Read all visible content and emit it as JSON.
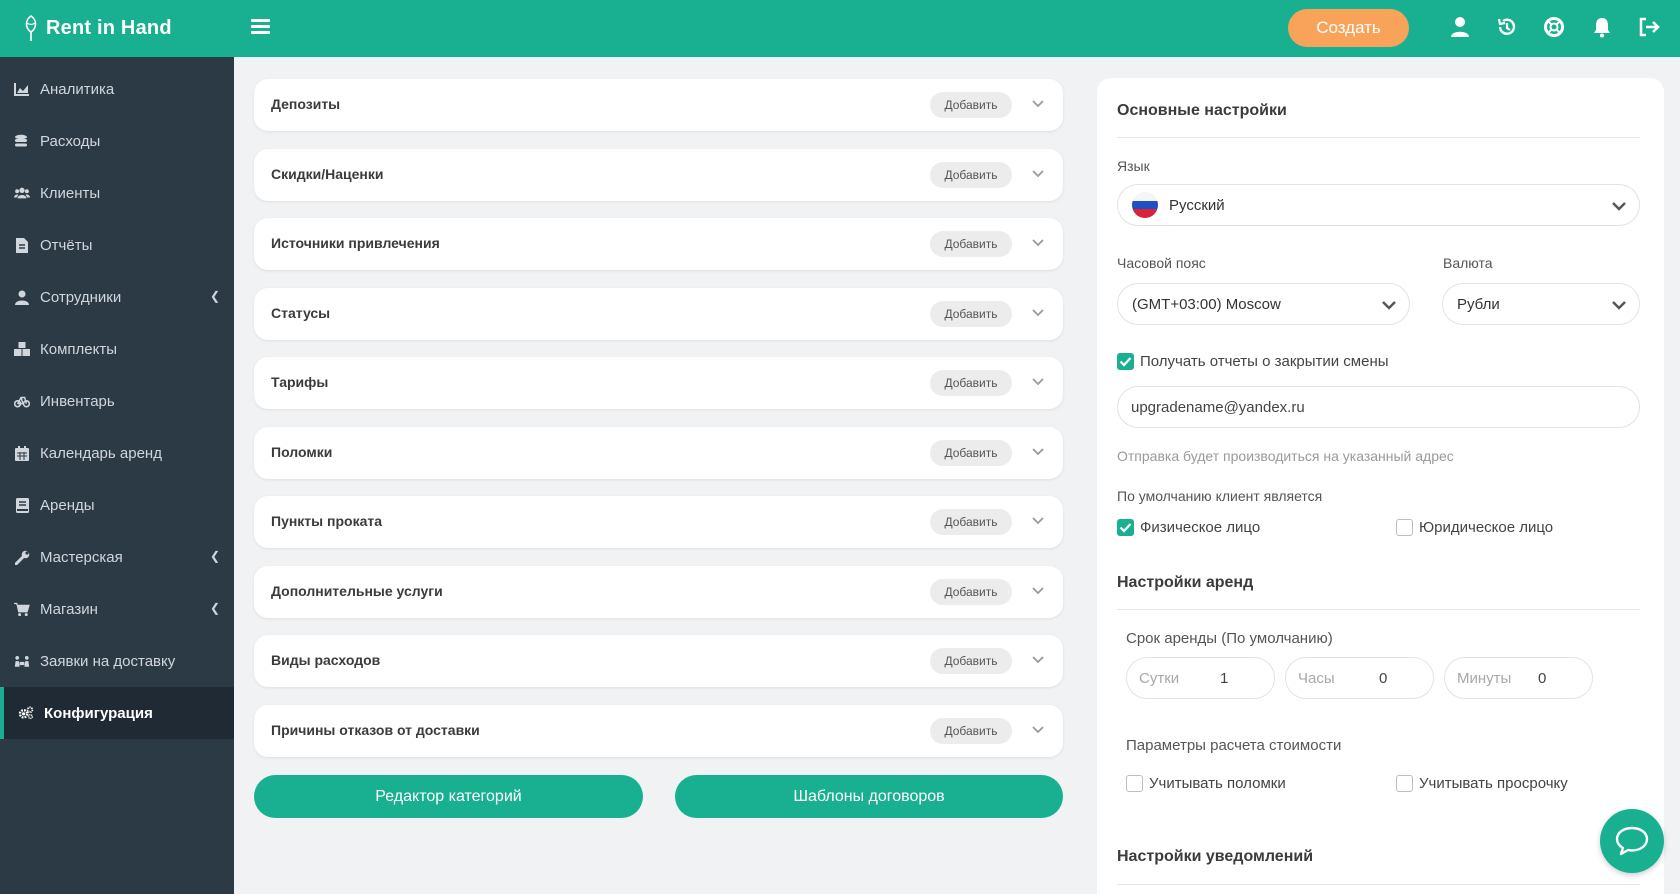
{
  "app": {
    "name": "Rent in Hand"
  },
  "header": {
    "create_label": "Создать"
  },
  "sidebar": {
    "items": [
      {
        "label": "Аналитика",
        "icon": "chart-icon"
      },
      {
        "label": "Расходы",
        "icon": "coins-icon"
      },
      {
        "label": "Клиенты",
        "icon": "users-icon"
      },
      {
        "label": "Отчёты",
        "icon": "file-icon"
      },
      {
        "label": "Сотрудники",
        "icon": "user-tie-icon"
      },
      {
        "label": "Комплекты",
        "icon": "boxes-icon"
      },
      {
        "label": "Инвентарь",
        "icon": "bicycle-icon"
      },
      {
        "label": "Календарь аренд",
        "icon": "calendar-icon"
      },
      {
        "label": "Аренды",
        "icon": "book-icon"
      },
      {
        "label": "Мастерская",
        "icon": "wrench-icon"
      },
      {
        "label": "Магазин",
        "icon": "cart-icon"
      },
      {
        "label": "Заявки на доставку",
        "icon": "delivery-icon"
      },
      {
        "label": "Конфигурация",
        "icon": "gears-icon"
      }
    ]
  },
  "sections": {
    "add_label": "Добавить",
    "items": [
      "Депозиты",
      "Скидки/Наценки",
      "Источники привлечения",
      "Статусы",
      "Тарифы",
      "Поломки",
      "Пункты проката",
      "Дополнительные услуги",
      "Виды расходов",
      "Причины отказов от доставки"
    ],
    "category_editor_label": "Редактор категорий",
    "contract_templates_label": "Шаблоны договоров"
  },
  "settings": {
    "basic_title": "Основные настройки",
    "language_label": "Язык",
    "language_value": "Русский",
    "timezone_label": "Часовой пояс",
    "timezone_value": "(GMT+03:00) Moscow",
    "currency_label": "Валюта",
    "currency_value": "Рубли",
    "shift_report_label": "Получать отчеты о закрытии смены",
    "shift_report_checked": true,
    "email_value": "upgradename@yandex.ru",
    "email_hint": "Отправка будет производиться на указанный адрес",
    "default_client_label": "По умолчанию клиент является",
    "individual_label": "Физическое лицо",
    "individual_checked": true,
    "legal_label": "Юридическое лицо",
    "legal_checked": false,
    "rent_title": "Настройки аренд",
    "rent_term_label": "Срок аренды (По умолчанию)",
    "days_placeholder": "Сутки",
    "days_value": "1",
    "hours_placeholder": "Часы",
    "hours_value": "0",
    "minutes_placeholder": "Минуты",
    "minutes_value": "0",
    "cost_params_label": "Параметры расчета стоимости",
    "breakdowns_label": "Учитывать поломки",
    "breakdowns_checked": false,
    "overdue_label": "Учитывать просрочку",
    "overdue_checked": false,
    "notifications_title": "Настройки уведомлений"
  },
  "colors": {
    "accent": "#19b092",
    "sidebar": "#2c3a46",
    "create": "#f9a35a"
  }
}
